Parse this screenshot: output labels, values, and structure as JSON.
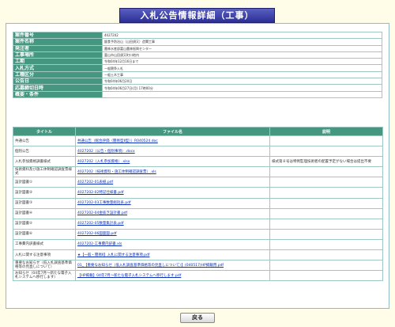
{
  "page_title": "入札公告情報詳細（工事）",
  "info": [
    {
      "label": "案件番号",
      "value": "4027202"
    },
    {
      "label": "案件名称",
      "value": "飯食予防治山（山田須又）造閘工事"
    },
    {
      "label": "発注者",
      "value": "農林水産部富山農林振興センター"
    },
    {
      "label": "工事場所",
      "value": "富山市山田須又町口地内"
    },
    {
      "label": "工期",
      "value": "令和04年12月16日まで"
    },
    {
      "label": "入札方式",
      "value": "一般競争入札"
    },
    {
      "label": "工種区分",
      "value": "一般土木工事"
    },
    {
      "label": "公告日",
      "value": "令和04年06月20日"
    },
    {
      "label": "応募締切日時",
      "value": "令和04年06月27日(月) 17時00分"
    },
    {
      "label": "概要・条件",
      "value": ""
    }
  ],
  "files_header": {
    "title": "タイトル",
    "filename": "ファイル名",
    "note": "説明"
  },
  "files": [
    {
      "title": "共通公告",
      "filename": "共通公告（総合評価（簡易型Ⅱ型））R040524.doc",
      "note": ""
    },
    {
      "title": "個別公告",
      "filename": "4027202（公告・個別事項）.docx",
      "note": ""
    },
    {
      "title": "入札参加資格調書様式",
      "filename": "4027202（入札参加資格）.xlsx",
      "note": "様式第８号は特例監理技術者の配置予定がない場合は提出不要"
    },
    {
      "title": "技術資料及び施工体制確認調査票様式",
      "filename": "4027202（技術資料・施工体制確認調査票）.xls",
      "note": ""
    },
    {
      "title": "設計図書①",
      "filename": "4027202-01表紙.pdf",
      "note": ""
    },
    {
      "title": "設計図書②",
      "filename": "4027202-02特記仕様書.pdf",
      "note": ""
    },
    {
      "title": "設計図書③",
      "filename": "4027202-03工事数量総括表.pdf",
      "note": ""
    },
    {
      "title": "設計図書④",
      "filename": "4027202-04金抜き設計書.pdf",
      "note": ""
    },
    {
      "title": "設計図書⑤",
      "filename": "4027202-05数量集計表.pdf",
      "note": ""
    },
    {
      "title": "設計図書⑥",
      "filename": "4027202-06図面図.pdf",
      "note": ""
    },
    {
      "title": "工事費内訳書様式",
      "filename": "4027202-工事費内訳書.xls",
      "note": ""
    },
    {
      "title": "入札に関する注意事項",
      "filename": "★【一般・簡易Ⅱ】入札に関する注意事項.pdf",
      "note": ""
    },
    {
      "title": "重要なお知らせ（低入札調査基準価格等の見直しについて）",
      "filename": "01_【重要なお知らせ（低入札調査基準価格等の見直しについて）】(040517)HP掲載用.pdf",
      "note": ""
    },
    {
      "title": "お知らせ（04年7月～新たな電子入札システムへ移行します）",
      "filename": "【HP掲載】04年7月～新たな電子入札システムへ移行します.pdf",
      "note": ""
    }
  ],
  "back_button": "戻る"
}
